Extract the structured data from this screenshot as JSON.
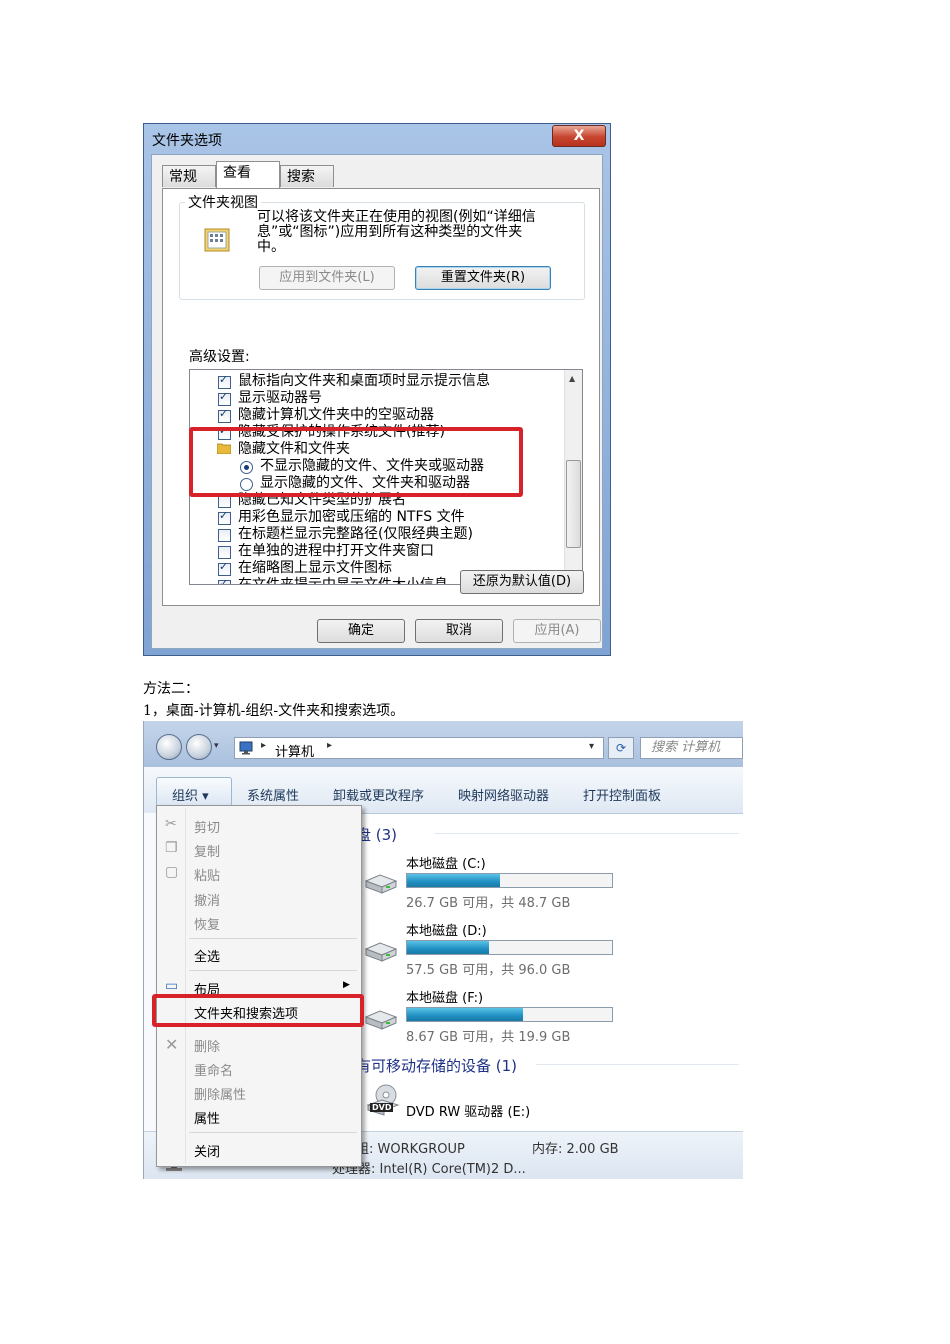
{
  "dialog": {
    "title": "文件夹选项",
    "close": "X",
    "tabs": [
      "常规",
      "查看",
      "搜索"
    ],
    "folder_views": {
      "group_label": "文件夹视图",
      "description_lines": [
        "可以将该文件夹正在使用的视图(例如“详细信",
        "息”或“图标”)应用到所有这种类型的文件夹",
        "中。"
      ],
      "apply_button": "应用到文件夹(L)",
      "reset_button": "重置文件夹(R)"
    },
    "advanced_label": "高级设置:",
    "settings": [
      {
        "label": "鼠标指向文件夹和桌面项时显示提示信息",
        "kind": "checkbox",
        "checked": true
      },
      {
        "label": "显示驱动器号",
        "kind": "checkbox",
        "checked": true
      },
      {
        "label": "隐藏计算机文件夹中的空驱动器",
        "kind": "checkbox",
        "checked": true
      },
      {
        "label": "隐藏受保护的操作系统文件(推荐)",
        "kind": "checkbox",
        "checked": true
      },
      {
        "label": "隐藏文件和文件夹",
        "kind": "folder"
      },
      {
        "label": "不显示隐藏的文件、文件夹或驱动器",
        "kind": "radio",
        "checked": true
      },
      {
        "label": "显示隐藏的文件、文件夹和驱动器",
        "kind": "radio",
        "checked": false
      },
      {
        "label": "隐藏已知文件类型的扩展名",
        "kind": "checkbox",
        "checked": false
      },
      {
        "label": "用彩色显示加密或压缩的 NTFS 文件",
        "kind": "checkbox",
        "checked": true
      },
      {
        "label": "在标题栏显示完整路径(仅限经典主题)",
        "kind": "checkbox",
        "checked": false
      },
      {
        "label": "在单独的进程中打开文件夹窗口",
        "kind": "checkbox",
        "checked": false
      },
      {
        "label": "在缩略图上显示文件图标",
        "kind": "checkbox",
        "checked": true
      },
      {
        "label": "在文件夹提示中显示文件大小信息",
        "kind": "checkbox",
        "checked": true
      }
    ],
    "restore_button": "还原为默认值(D)",
    "ok_button": "确定",
    "cancel_button": "取消",
    "apply_button": "应用(A)"
  },
  "text": {
    "method": "方法二：",
    "step": "1，桌面-计算机-组织-文件夹和搜索选项。"
  },
  "explorer": {
    "breadcrumb": "计算机",
    "search_placeholder": "搜索 计算机",
    "commands": [
      "组织 ▾",
      "系统属性",
      "卸载或更改程序",
      "映射网络驱动器",
      "打开控制面板"
    ],
    "menu_items": [
      {
        "label": "剪切",
        "dim": true
      },
      {
        "label": "复制",
        "dim": true
      },
      {
        "label": "粘贴",
        "dim": true
      },
      {
        "label": "撤消",
        "dim": true
      },
      {
        "label": "恢复",
        "dim": true
      },
      {
        "label": "全选",
        "dim": false
      },
      {
        "label": "布局",
        "dim": false
      },
      {
        "label": "文件夹和搜索选项",
        "dim": false
      },
      {
        "label": "删除",
        "dim": true
      },
      {
        "label": "重命名",
        "dim": true
      },
      {
        "label": "删除属性",
        "dim": true
      },
      {
        "label": "属性",
        "dim": false
      },
      {
        "label": "关闭",
        "dim": false
      }
    ],
    "hdd_section": "盘 (3)",
    "drives": [
      {
        "name": "本地磁盘 (C:)",
        "free": "26.7 GB 可用，共 48.7 GB",
        "used_fraction": 0.452
      },
      {
        "name": "本地磁盘 (D:)",
        "free": "57.5 GB 可用，共 96.0 GB",
        "used_fraction": 0.401
      },
      {
        "name": "本地磁盘 (F:)",
        "free": "8.67 GB 可用，共 19.9 GB",
        "used_fraction": 0.564
      }
    ],
    "removable_section": "有可移动存储的设备 (1)",
    "dvd_name": "DVD RW 驱动器 (E:)",
    "dvd_badge": "DVD",
    "workgroup": "组: WORKGROUP",
    "memory": "内存: 2.00 GB",
    "processor": "处理器: Intel(R) Core(TM)2 D..."
  }
}
